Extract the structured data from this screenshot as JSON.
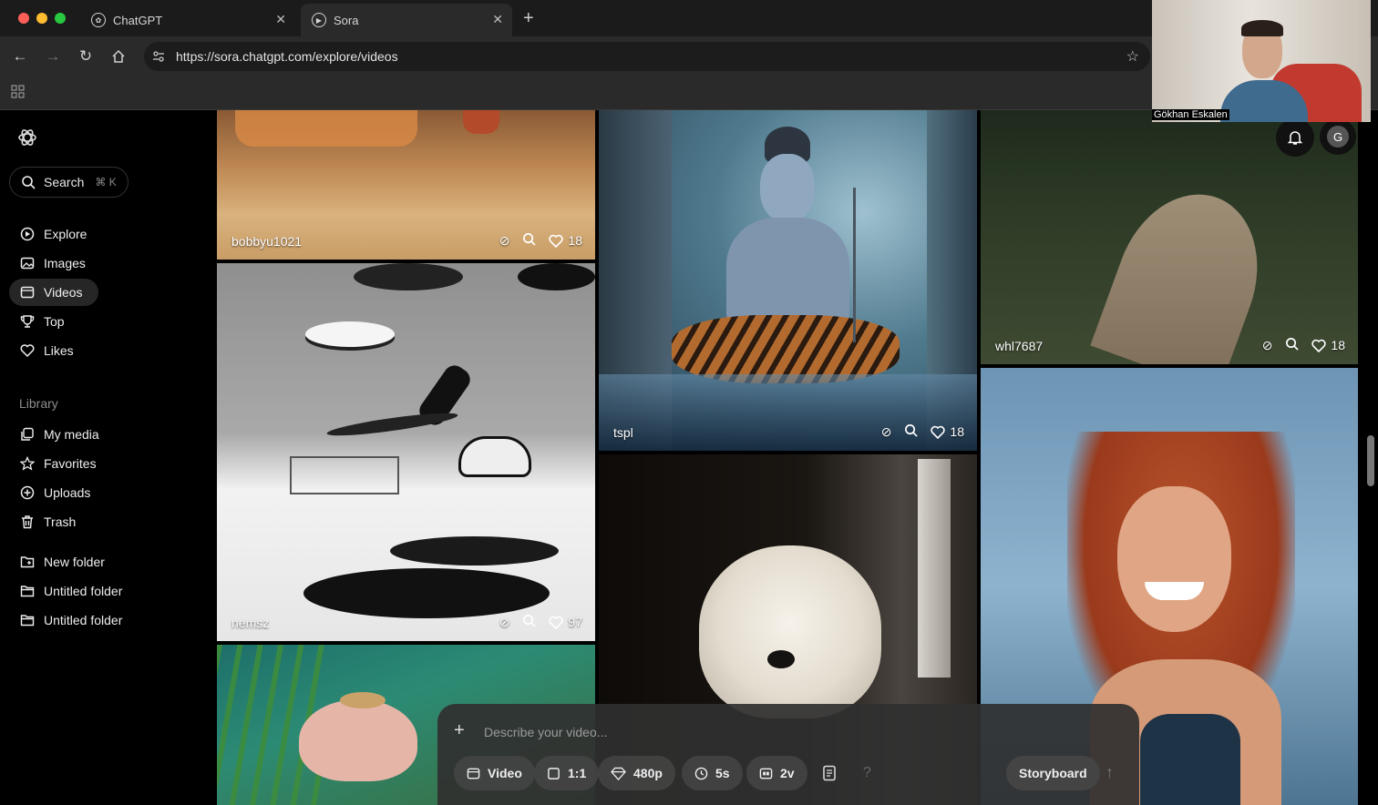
{
  "browser": {
    "tabs": [
      {
        "title": "ChatGPT"
      },
      {
        "title": "Sora"
      }
    ],
    "url": "https://sora.chatgpt.com/explore/videos"
  },
  "webcam": {
    "name": "Gökhan Eskalen"
  },
  "user": {
    "avatar_letter": "G"
  },
  "sidebar": {
    "search": {
      "label": "Search",
      "shortcut": "⌘ K"
    },
    "nav": [
      {
        "label": "Explore",
        "icon": "compass-icon"
      },
      {
        "label": "Images",
        "icon": "image-icon"
      },
      {
        "label": "Videos",
        "icon": "video-icon",
        "active": true
      },
      {
        "label": "Top",
        "icon": "trophy-icon"
      },
      {
        "label": "Likes",
        "icon": "heart-icon"
      }
    ],
    "library_heading": "Library",
    "library": [
      {
        "label": "My media",
        "icon": "media-icon"
      },
      {
        "label": "Favorites",
        "icon": "star-icon"
      },
      {
        "label": "Uploads",
        "icon": "upload-icon"
      },
      {
        "label": "Trash",
        "icon": "trash-icon"
      }
    ],
    "folders": [
      {
        "label": "New folder",
        "icon": "folder-plus-icon"
      },
      {
        "label": "Untitled folder",
        "icon": "folder-icon"
      },
      {
        "label": "Untitled folder",
        "icon": "folder-icon"
      }
    ]
  },
  "feed": [
    {
      "user": "bobbyu1021",
      "likes": "18"
    },
    {
      "user": "nemsz",
      "likes": "97"
    },
    {
      "user": "tspl",
      "likes": "18"
    },
    {
      "user": "whl7687",
      "likes": "18"
    }
  ],
  "composer": {
    "placeholder": "Describe your video...",
    "chips": [
      {
        "label": "Video",
        "icon": "video-icon"
      },
      {
        "label": "1:1",
        "icon": "aspect-icon"
      },
      {
        "label": "480p",
        "icon": "diamond-icon"
      },
      {
        "label": "5s",
        "icon": "clock-icon"
      },
      {
        "label": "2v",
        "icon": "variations-icon"
      }
    ],
    "help": "?",
    "storyboard": "Storyboard"
  }
}
